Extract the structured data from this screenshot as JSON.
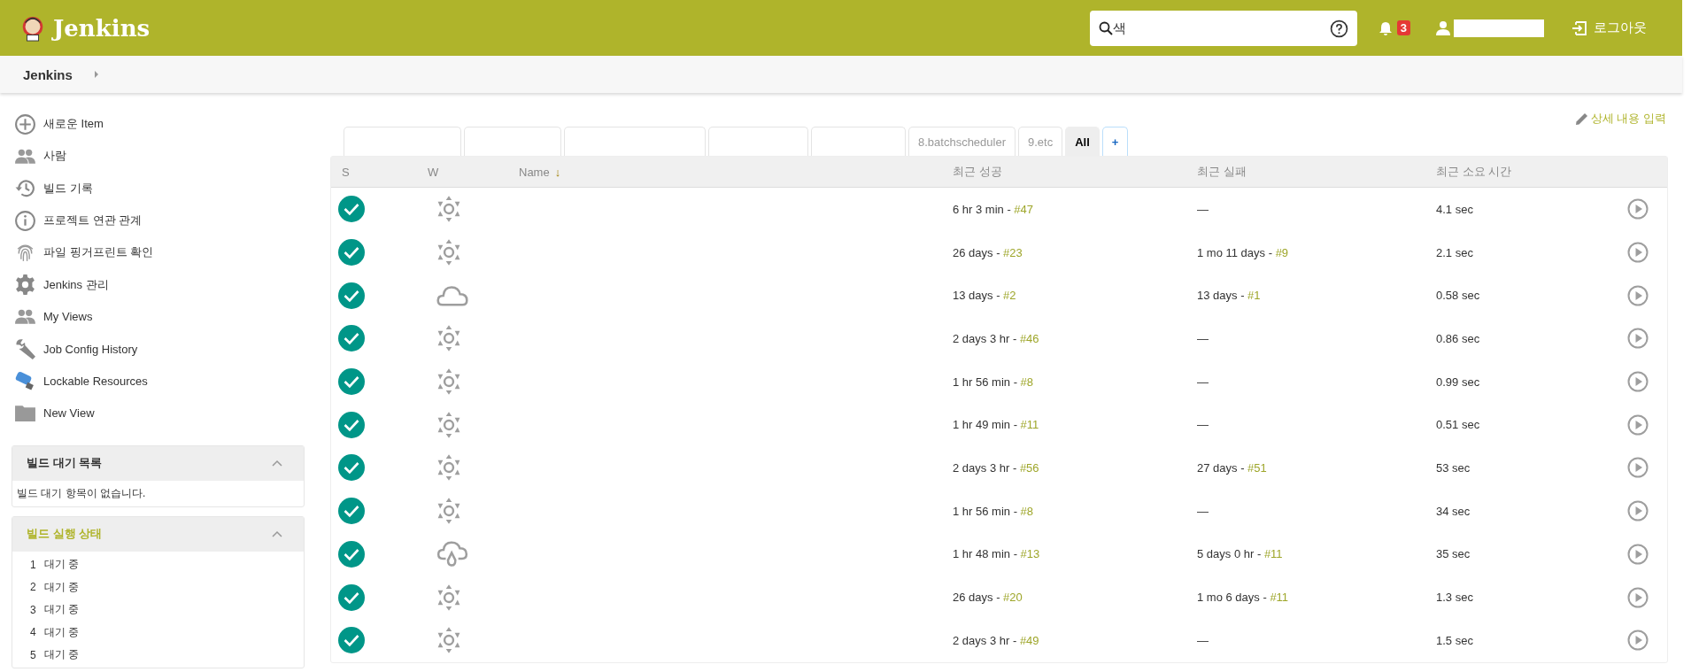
{
  "header": {
    "logo_text": "Jenkins",
    "search": {
      "placeholder": "색"
    },
    "notifications": {
      "count": "3"
    },
    "logout": "로그아웃"
  },
  "breadcrumb": [
    {
      "label": "Jenkins"
    }
  ],
  "sidebar": {
    "tasks": [
      {
        "kind": "add",
        "label": "새로운 Item"
      },
      {
        "kind": "people",
        "label": "사람"
      },
      {
        "kind": "history",
        "label": "빌드 기록"
      },
      {
        "kind": "info",
        "label": "프로젝트 연관 관계"
      },
      {
        "kind": "fingerprint",
        "label": "파일 핑거프린트 확인"
      },
      {
        "kind": "gear",
        "label": "Jenkins 관리"
      },
      {
        "kind": "people",
        "label": "My Views"
      },
      {
        "kind": "wrench",
        "label": "Job Config History"
      },
      {
        "kind": "usb",
        "label": "Lockable Resources"
      },
      {
        "kind": "folder",
        "label": "New View"
      }
    ],
    "queue": {
      "title": "빌드 대기 목록",
      "expanded": true,
      "message": "빌드 대기 항목이 없습니다."
    },
    "executors": {
      "title": "빌드 실행 상태",
      "expanded": true,
      "items": [
        {
          "number": "1",
          "status": "대기 중"
        },
        {
          "number": "2",
          "status": "대기 중"
        },
        {
          "number": "3",
          "status": "대기 중"
        },
        {
          "number": "4",
          "status": "대기 중"
        },
        {
          "number": "5",
          "status": "대기 중"
        }
      ]
    }
  },
  "edit_description": "상세 내용 입력",
  "tabs": [
    {
      "kind": "view",
      "selected": false
    },
    {
      "kind": "view",
      "selected": false
    },
    {
      "kind": "view",
      "selected": false
    },
    {
      "kind": "view",
      "selected": false
    },
    {
      "kind": "view",
      "selected": false
    },
    {
      "kind": "view",
      "label": "8.batchscheduler",
      "selected": false
    },
    {
      "kind": "view",
      "label": "9.etc",
      "selected": false
    },
    {
      "kind": "view",
      "label": "All",
      "selected": true
    },
    {
      "kind": "add",
      "label": "+",
      "selected": false
    }
  ],
  "table": {
    "columns": [
      {
        "label": "S"
      },
      {
        "label": "W"
      },
      {
        "label": "Name",
        "sort": "↓"
      },
      {
        "label": "최근 성공"
      },
      {
        "label": "최근 실패"
      },
      {
        "label": "최근 소요 시간"
      }
    ],
    "rows": [
      {
        "status": {
          "kind": "success"
        },
        "weather": {
          "kind": "sunny"
        },
        "last_success": {
          "time": "6 hr 3 min - ",
          "build": "#47"
        },
        "last_failure": {
          "time": "—"
        },
        "duration": "4.1 sec"
      },
      {
        "status": {
          "kind": "success"
        },
        "weather": {
          "kind": "sunny"
        },
        "last_success": {
          "time": "26 days - ",
          "build": "#23"
        },
        "last_failure": {
          "time": "1 mo 11 days - ",
          "build": "#9"
        },
        "duration": "2.1 sec"
      },
      {
        "status": {
          "kind": "success"
        },
        "weather": {
          "kind": "cloudy"
        },
        "last_success": {
          "time": "13 days - ",
          "build": "#2"
        },
        "last_failure": {
          "time": "13 days - ",
          "build": "#1"
        },
        "duration": "0.58 sec"
      },
      {
        "status": {
          "kind": "success"
        },
        "weather": {
          "kind": "sunny"
        },
        "last_success": {
          "time": "2 days 3 hr - ",
          "build": "#46"
        },
        "last_failure": {
          "time": "—"
        },
        "duration": "0.86 sec"
      },
      {
        "status": {
          "kind": "success"
        },
        "weather": {
          "kind": "sunny"
        },
        "last_success": {
          "time": "1 hr 56 min - ",
          "build": "#8"
        },
        "last_failure": {
          "time": "—"
        },
        "duration": "0.99 sec"
      },
      {
        "status": {
          "kind": "success"
        },
        "weather": {
          "kind": "sunny"
        },
        "last_success": {
          "time": "1 hr 49 min - ",
          "build": "#11"
        },
        "last_failure": {
          "time": "—"
        },
        "duration": "0.51 sec"
      },
      {
        "status": {
          "kind": "success"
        },
        "weather": {
          "kind": "sunny"
        },
        "last_success": {
          "time": "2 days 3 hr - ",
          "build": "#56"
        },
        "last_failure": {
          "time": "27 days - ",
          "build": "#51"
        },
        "duration": "53 sec"
      },
      {
        "status": {
          "kind": "success"
        },
        "weather": {
          "kind": "sunny"
        },
        "last_success": {
          "time": "1 hr 56 min - ",
          "build": "#8"
        },
        "last_failure": {
          "time": "—"
        },
        "duration": "34 sec"
      },
      {
        "status": {
          "kind": "success"
        },
        "weather": {
          "kind": "rain"
        },
        "last_success": {
          "time": "1 hr 48 min - ",
          "build": "#13"
        },
        "last_failure": {
          "time": "5 days 0 hr - ",
          "build": "#11"
        },
        "duration": "35 sec"
      },
      {
        "status": {
          "kind": "success"
        },
        "weather": {
          "kind": "sunny"
        },
        "last_success": {
          "time": "26 days - ",
          "build": "#20"
        },
        "last_failure": {
          "time": "1 mo 6 days - ",
          "build": "#11"
        },
        "duration": "1.3 sec"
      },
      {
        "status": {
          "kind": "success"
        },
        "weather": {
          "kind": "sunny"
        },
        "last_success": {
          "time": "2 days 3 hr - ",
          "build": "#49"
        },
        "last_failure": {
          "time": "—"
        },
        "duration": "1.5 sec"
      }
    ]
  }
}
